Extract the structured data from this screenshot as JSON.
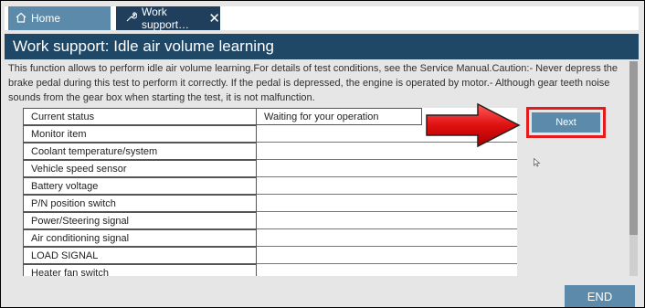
{
  "tabs": [
    {
      "label": "Home",
      "icon": "home-icon"
    },
    {
      "label": "Work support…",
      "icon": "wrench-icon",
      "close": "✕"
    }
  ],
  "header": {
    "title": "Work support: Idle air volume learning"
  },
  "description": "This function allows to perform idle air volume learning.For details of test conditions, see the Service Manual.Caution:- Never depress the brake pedal during this test to perform it correctly. If the pedal is depressed, the engine is operated by motor.- Although gear teeth noise sounds from the gear box when starting the test, it is not malfunction.",
  "table": {
    "rows": [
      {
        "label": "Current status",
        "value": "Waiting for your operation"
      },
      {
        "label": "Monitor item",
        "value": ""
      },
      {
        "label": "Coolant temperature/system",
        "value": ""
      },
      {
        "label": "Vehicle speed sensor",
        "value": ""
      },
      {
        "label": "Battery voltage",
        "value": ""
      },
      {
        "label": "P/N position switch",
        "value": ""
      },
      {
        "label": "Power/Steering signal",
        "value": ""
      },
      {
        "label": "Air conditioning signal",
        "value": ""
      },
      {
        "label": "LOAD SIGNAL",
        "value": ""
      },
      {
        "label": "Heater fan switch",
        "value": ""
      }
    ]
  },
  "buttons": {
    "next": "Next",
    "end": "END"
  },
  "colors": {
    "accent": "#5b8aaa",
    "header": "#1f4766",
    "highlight": "#e41b1b"
  }
}
